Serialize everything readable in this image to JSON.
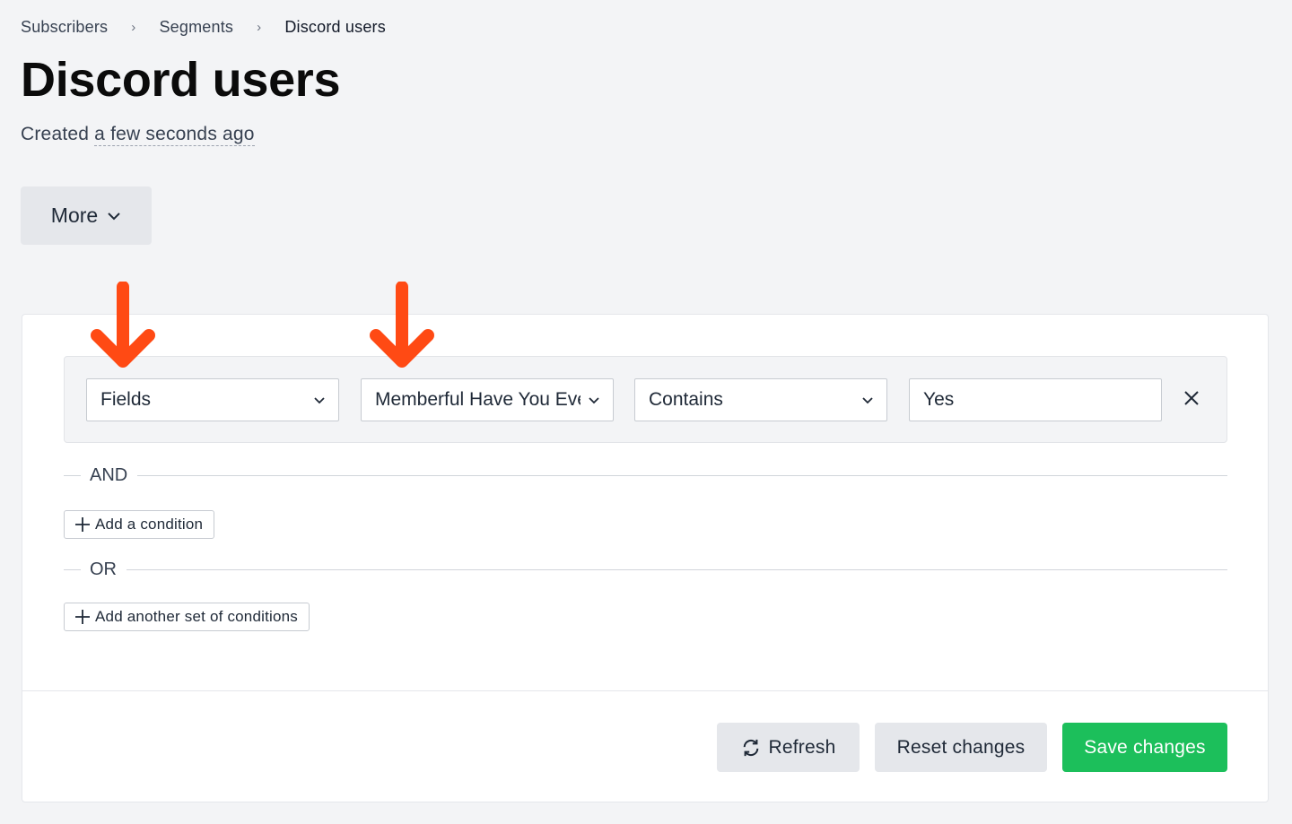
{
  "breadcrumb": {
    "items": [
      "Subscribers",
      "Segments",
      "Discord users"
    ],
    "separator": "›"
  },
  "page": {
    "title": "Discord users",
    "created_prefix": "Created",
    "created_ago": "a few seconds ago"
  },
  "more_button": {
    "label": "More"
  },
  "condition": {
    "field_type": "Fields",
    "field_name": "Memberful Have You Ever",
    "operator": "Contains",
    "value": "Yes"
  },
  "logic": {
    "and_label": "AND",
    "add_condition": "Add a condition",
    "or_label": "OR",
    "add_condition_set": "Add another set of conditions"
  },
  "footer": {
    "refresh": "Refresh",
    "reset": "Reset changes",
    "save": "Save changes"
  },
  "colors": {
    "annotation_arrow": "#ff4a14",
    "save_button": "#1cbf5b",
    "page_background": "#f3f4f6"
  }
}
